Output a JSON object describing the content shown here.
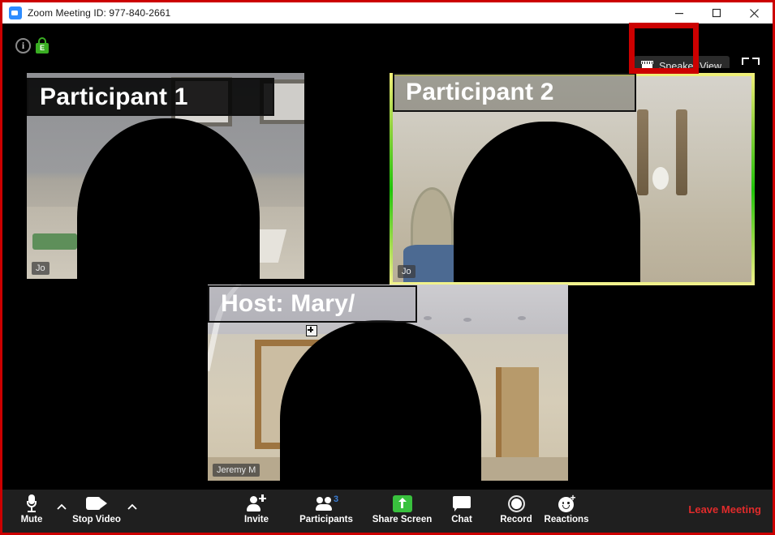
{
  "window": {
    "app_icon": "zoom-logo-icon",
    "title": "Zoom Meeting ID: 977-840-2661",
    "minimize_label": "minimize-icon",
    "maximize_label": "maximize-icon",
    "close_label": "close-icon"
  },
  "infobar": {
    "info_icon_glyph": "i",
    "info_icon_name": "meeting-information-icon",
    "encryption_icon_name": "encryption-lock-icon",
    "encryption_glyph": "E",
    "view_button_label": "Speaker View",
    "view_button_icon": "layout-grid-icon",
    "fullscreen_icon": "enter-full-screen-icon"
  },
  "annotation": {
    "highlight_color": "#cc0000",
    "frame_color": "#cc0000"
  },
  "stage": {
    "tiles": [
      {
        "id": "tile-1",
        "name_badge": "Jo",
        "active_speaker": false
      },
      {
        "id": "tile-2",
        "name_badge": "Jo",
        "active_speaker": true,
        "active_border_color": "#9fd83c"
      },
      {
        "id": "tile-3",
        "name_badge": "Jeremy M",
        "active_speaker": false
      }
    ],
    "captions": [
      {
        "id": "caption-participant-1",
        "text": "Participant 1"
      },
      {
        "id": "caption-participant-2",
        "text": "Participant 2"
      },
      {
        "id": "caption-host",
        "text": "Host: Mary/"
      }
    ]
  },
  "toolbar": {
    "mute": {
      "label": "Mute",
      "icon": "microphone-icon"
    },
    "audio_options": {
      "label": "",
      "icon": "chevron-up-icon"
    },
    "stop_video": {
      "label": "Stop Video",
      "icon": "video-camera-icon"
    },
    "video_options": {
      "label": "",
      "icon": "chevron-up-icon"
    },
    "invite": {
      "label": "Invite",
      "icon": "add-person-icon"
    },
    "participants": {
      "label": "Participants",
      "icon": "people-icon",
      "count": "3",
      "count_color": "#3a7dd4"
    },
    "share_screen": {
      "label": "Share Screen",
      "icon": "share-screen-icon",
      "accent": "#39c13e"
    },
    "chat": {
      "label": "Chat",
      "icon": "chat-bubble-icon"
    },
    "record": {
      "label": "Record",
      "icon": "record-circle-icon"
    },
    "reactions": {
      "label": "Reactions",
      "icon": "smiley-reactions-icon"
    },
    "leave": {
      "label": "Leave Meeting",
      "color": "#e02b2b"
    }
  }
}
